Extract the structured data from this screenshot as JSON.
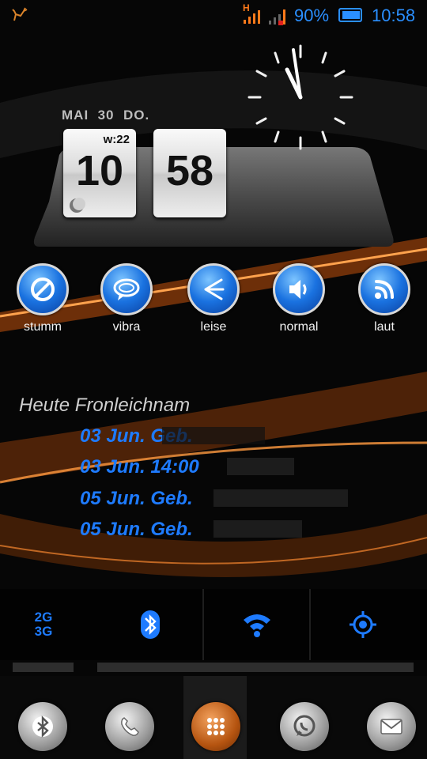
{
  "status_bar": {
    "network_label": "H",
    "battery_percent": "90%",
    "time": "10:58",
    "icons": [
      "deer-icon",
      "signal-icon",
      "signal-no-sim-icon",
      "battery-icon"
    ]
  },
  "clock_widget": {
    "date": "MAI  30  DO.",
    "hour": "10",
    "minute": "58",
    "week": "w:22"
  },
  "sound_profiles": [
    {
      "label": "stumm",
      "icon": "mute-icon"
    },
    {
      "label": "vibra",
      "icon": "vibrate-icon"
    },
    {
      "label": "leise",
      "icon": "quiet-icon"
    },
    {
      "label": "normal",
      "icon": "speaker-icon"
    },
    {
      "label": "laut",
      "icon": "loud-icon"
    }
  ],
  "calendar": {
    "header": "Heute Fronleichnam",
    "events": [
      "03 Jun. Geb.",
      "03 Jun. 14:00",
      "05 Jun. Geb.",
      "05 Jun. Geb."
    ]
  },
  "quick_toggles": {
    "network_mode": "2G\n3G",
    "icons": [
      "network-mode-icon",
      "bluetooth-icon",
      "wifi-icon",
      "gps-icon"
    ],
    "accent": "#1e7bff"
  },
  "dock": {
    "icons": [
      "bluetooth-dock-icon",
      "phone-icon",
      "app-drawer-icon",
      "whatsapp-icon",
      "mail-icon"
    ]
  }
}
